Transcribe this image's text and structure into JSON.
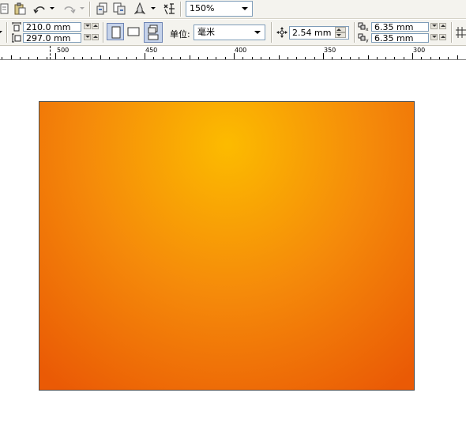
{
  "toolbar": {
    "zoom": {
      "value": "150%"
    }
  },
  "property_bar": {
    "page_width": "210.0 mm",
    "page_height": "297.0 mm",
    "units_label": "单位:",
    "units_value": "毫米",
    "nudge_value": "2.54 mm",
    "duplicate_x": "6.35 mm",
    "duplicate_y": "6.35 mm"
  },
  "ruler": {
    "labels": [
      "500",
      "450",
      "400",
      "350",
      "300"
    ]
  },
  "canvas": {
    "page_fill_colors": {
      "center": "#fcbb00",
      "mid": "#f58a0a",
      "edge": "#ea5a05"
    },
    "page_border_color": "#4a4a4a"
  }
}
